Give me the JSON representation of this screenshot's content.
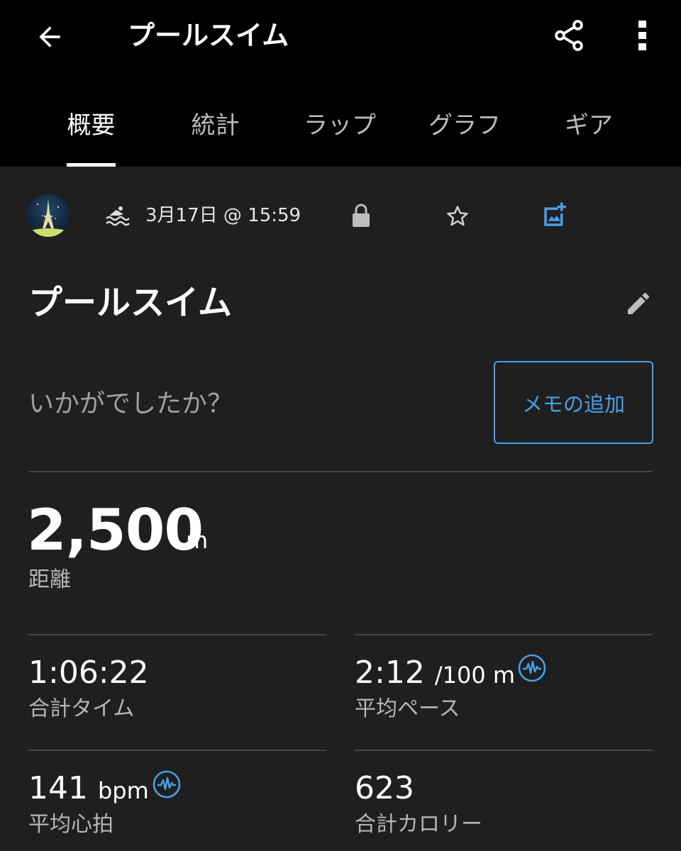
{
  "header": {
    "back_icon": "arrow-left-icon",
    "title": "プールスイム",
    "share_icon": "share-icon",
    "more_icon": "more-vertical-icon"
  },
  "tabs": [
    {
      "label": "概要",
      "active": true
    },
    {
      "label": "統計",
      "active": false
    },
    {
      "label": "ラップ",
      "active": false
    },
    {
      "label": "グラフ",
      "active": false
    },
    {
      "label": "ギア",
      "active": false
    }
  ],
  "meta": {
    "activity_icon": "pool-swim-icon",
    "date": "3月17日 @ 15:59",
    "privacy_icon": "lock-icon",
    "favorite_icon": "star-outline-icon",
    "add_photo_icon": "add-photo-icon"
  },
  "activity": {
    "title": "プールスイム",
    "edit_icon": "pencil-icon"
  },
  "feeling": {
    "prompt": "いかがでしたか？",
    "memo_button": "メモの追加"
  },
  "distance": {
    "value": "2,500",
    "unit": "m",
    "label": "距離"
  },
  "stats": {
    "total_time": {
      "value": "1:06:22",
      "label": "合計タイム"
    },
    "avg_pace": {
      "value": "2:12",
      "unit": "/100 m",
      "label": "平均ペース",
      "icon": "heart-rate-monitor-icon"
    },
    "avg_hr": {
      "value": "141",
      "unit": "bpm",
      "label": "平均心拍",
      "icon": "heart-rate-monitor-icon"
    },
    "calories": {
      "value": "623",
      "label": "合計カロリー"
    }
  },
  "colors": {
    "accent": "#4a9fe8",
    "background": "#1f1f1f",
    "topbar": "#000000",
    "divider": "#444444"
  }
}
